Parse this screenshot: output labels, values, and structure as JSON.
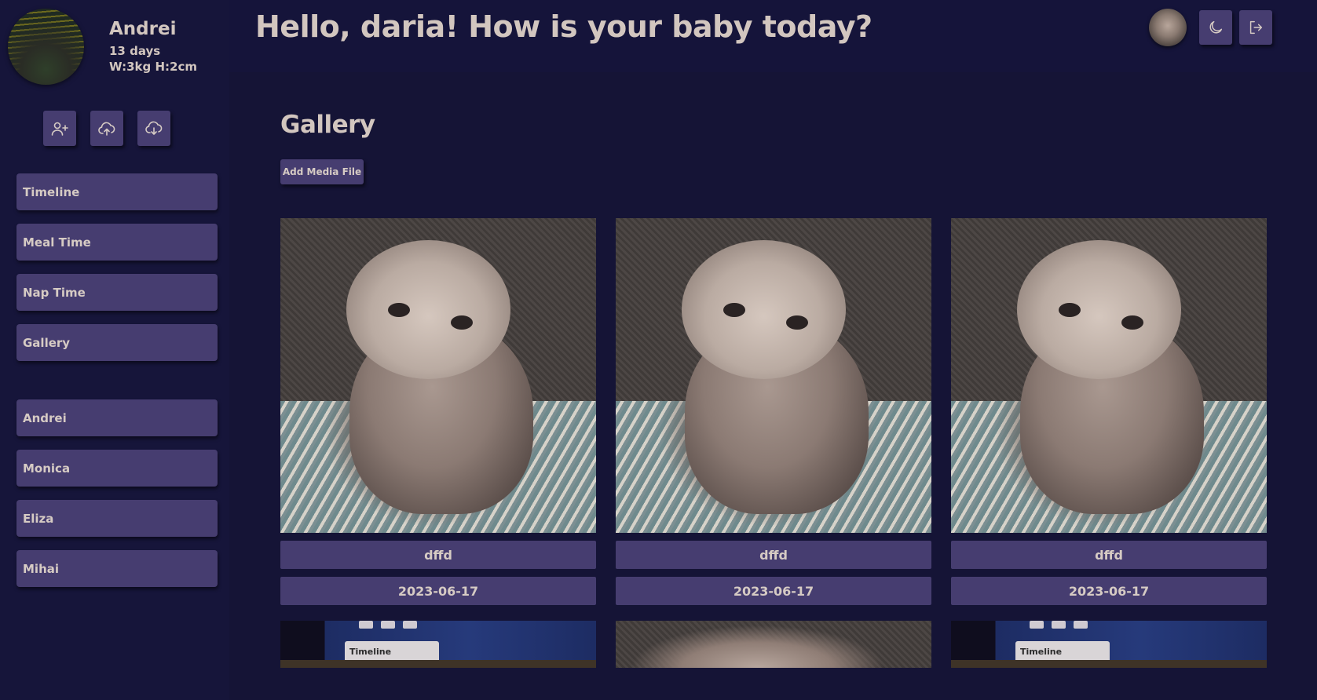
{
  "profile": {
    "name": "Andrei",
    "age": "13 days",
    "metrics": "W:3kg H:2cm"
  },
  "header": {
    "greeting": "Hello, daria! How is your baby today?"
  },
  "sidebar": {
    "nav": [
      {
        "label": "Timeline"
      },
      {
        "label": "Meal Time"
      },
      {
        "label": "Nap Time"
      },
      {
        "label": "Gallery"
      }
    ],
    "babies": [
      {
        "label": "Andrei"
      },
      {
        "label": "Monica"
      },
      {
        "label": "Eliza"
      },
      {
        "label": "Mihai"
      }
    ]
  },
  "main": {
    "heading": "Gallery",
    "add_media_label": "Add Media File",
    "items": [
      {
        "caption": "dffd",
        "date": "2023-06-17"
      },
      {
        "caption": "dffd",
        "date": "2023-06-17"
      },
      {
        "caption": "dffd",
        "date": "2023-06-17"
      }
    ],
    "partial_screenshot_label": "Timeline"
  },
  "icons": {
    "add_user": "person-plus-icon",
    "upload": "cloud-upload-icon",
    "download": "cloud-download-icon",
    "theme": "moon-icon",
    "logout": "logout-icon"
  },
  "colors": {
    "background": "#15143a",
    "button": "#463d70",
    "text": "#d2c6bf"
  }
}
